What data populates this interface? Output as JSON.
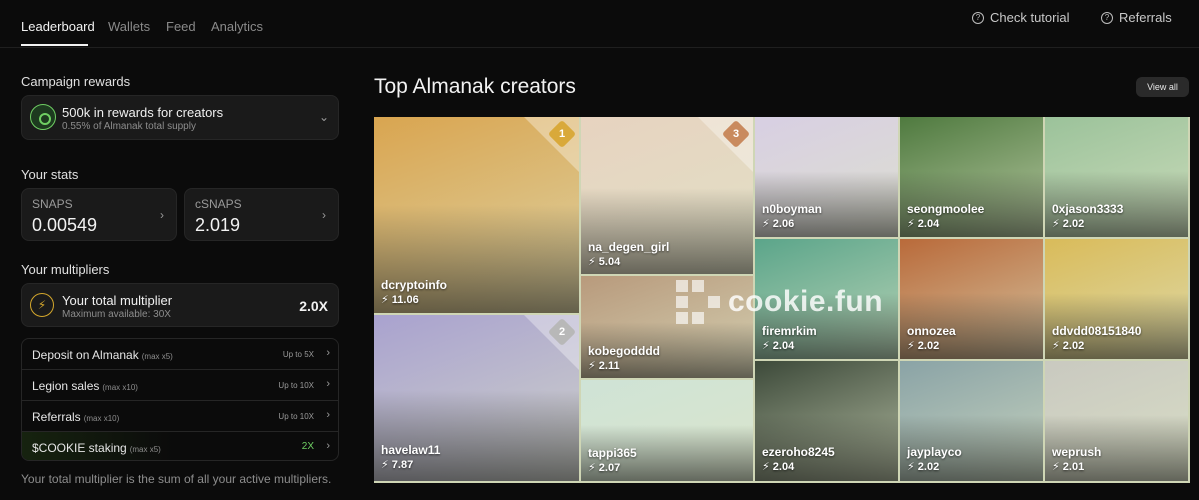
{
  "nav": {
    "tabs": [
      "Leaderboard",
      "Wallets",
      "Feed",
      "Analytics"
    ],
    "active_tab": "Leaderboard",
    "check_tutorial": "Check tutorial",
    "referrals": "Referrals"
  },
  "campaign": {
    "title": "Campaign rewards",
    "heading": "500k in rewards for creators",
    "sub": "0.55% of Almanak total supply"
  },
  "stats": {
    "title": "Your stats",
    "snaps_label": "SNAPS",
    "snaps_value": "0.00549",
    "csnaps_label": "cSNAPS",
    "csnaps_value": "2.019"
  },
  "multipliers": {
    "title": "Your multipliers",
    "total_label": "Your total multiplier",
    "max_available": "Maximum available: 30X",
    "total_value": "2.0X",
    "items": [
      {
        "label": "Deposit on Almanak",
        "max": "(max x5)",
        "up": "Up to 5X"
      },
      {
        "label": "Legion sales",
        "max": "(max x10)",
        "up": "Up to 10X"
      },
      {
        "label": "Referrals",
        "max": "(max x10)",
        "up": "Up to 10X"
      },
      {
        "label": "$COOKIE staking",
        "max": "(max x5)",
        "up": "2X"
      }
    ],
    "footnote": "Your total multiplier is the sum of all your active multipliers."
  },
  "creators": {
    "title": "Top Almanak creators",
    "view_all": "View all",
    "watermark": "cookie.fun",
    "tiles": [
      {
        "name": "dcryptoinfo",
        "score": "11.06",
        "rank": "1",
        "color": "#d9a550"
      },
      {
        "name": "havelaw11",
        "score": "7.87",
        "rank": "2",
        "color": "#a9a2cf"
      },
      {
        "name": "na_degen_girl",
        "score": "5.04",
        "rank": "3",
        "color": "#e7d3c0"
      },
      {
        "name": "kobegodddd",
        "score": "2.11",
        "rank": "",
        "color": "#b89a7c"
      },
      {
        "name": "tappi365",
        "score": "2.07",
        "rank": "",
        "color": "#cfe3d6"
      },
      {
        "name": "n0boyman",
        "score": "2.06",
        "rank": "",
        "color": "#d8cfe3"
      },
      {
        "name": "firemrkim",
        "score": "2.04",
        "rank": "",
        "color": "#5ba58a"
      },
      {
        "name": "ezeroho8245",
        "score": "2.04",
        "rank": "",
        "color": "#3d4a3a"
      },
      {
        "name": "seongmoolee",
        "score": "2.04",
        "rank": "",
        "color": "#4f7a3f"
      },
      {
        "name": "onnozea",
        "score": "2.02",
        "rank": "",
        "color": "#b96a3a"
      },
      {
        "name": "jayplayco",
        "score": "2.02",
        "rank": "",
        "color": "#8aa3a6"
      },
      {
        "name": "0xjason3333",
        "score": "2.02",
        "rank": "",
        "color": "#9bc29a"
      },
      {
        "name": "ddvdd08151840",
        "score": "2.02",
        "rank": "",
        "color": "#d9bb5a"
      },
      {
        "name": "weprush",
        "score": "2.01",
        "rank": "",
        "color": "#c9c9c0"
      }
    ]
  }
}
